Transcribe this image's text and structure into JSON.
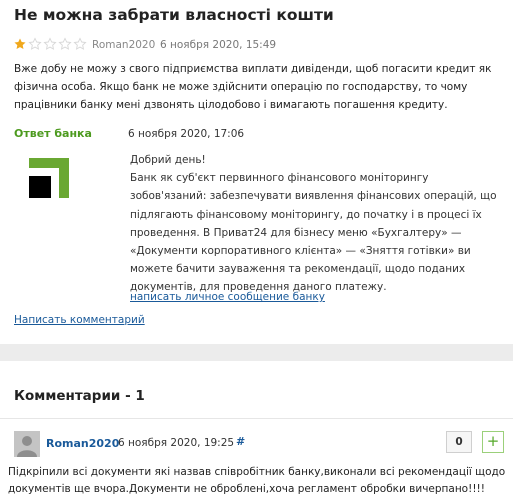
{
  "review": {
    "title": "Не можна забрати власності кошти",
    "rating": 1,
    "rating_max": 5,
    "author": "Roman2020",
    "date": "6 ноября 2020, 15:49",
    "text": "Вже добу не можу з свого підприємства виплати дивіденди, щоб погасити кредит як фізична особа. Якщо банк не може здійснити операцію по господарству, то чому працівники банку мені дзвонять цілодобово і вимагають погашення кредиту."
  },
  "bank_answer": {
    "label": "Ответ банка",
    "date": "6 ноября 2020, 17:06",
    "logo_icon": "privatbank-logo-icon",
    "greeting": "Добрий день!",
    "body": "Банк як суб'єкт первинного фінансового моніторингу зобов'язаний: забезпечувати виявлення фінансових операцій, що підлягають фінансовому моніторингу, до початку і в процесі їх проведення. В Приват24 для бізнесу меню «Бухгалтеру» — «Документи корпоративного клієнта» — «Зняття готівки» ви можете бачити зауваження та рекомендації, щодо поданих документів, для проведення даного платежу.",
    "private_message_link": "написать личное сообщение банку",
    "logo_colors": {
      "green": "#6aa832",
      "black": "#000000"
    }
  },
  "write_comment_link": "Написать комментарий",
  "comments": {
    "title": "Комментарии - 1",
    "items": [
      {
        "author": "Roman2020",
        "date": "6 ноября 2020, 19:25",
        "hash": "#",
        "votes": "0",
        "plus": "+",
        "text": "Підкріпили всі документи які назвав співробітник банку,виконали всі рекомендації щодо документів ще вчора.Документи не оброблені,хоча регламент обробки вичерпано!!!!"
      }
    ]
  },
  "colors": {
    "link": "#1a5a9a",
    "bank_green": "#4c9a1e",
    "star_filled": "#f0a81c",
    "star_empty": "#d8d8d8"
  }
}
